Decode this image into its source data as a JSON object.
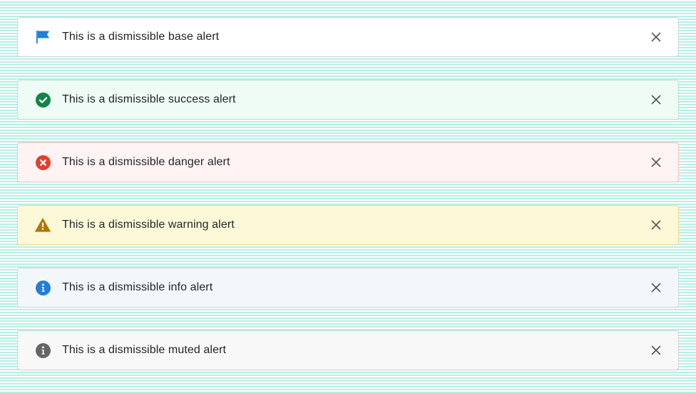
{
  "alerts": [
    {
      "variant": "base",
      "message": "This is a dismissible base alert",
      "icon": "flag-icon",
      "icon_color": "#1f7fd9",
      "dismiss_icon": "close-icon"
    },
    {
      "variant": "success",
      "message": "This is a dismissible success alert",
      "icon": "check-circle-icon",
      "icon_color": "#108548",
      "dismiss_icon": "close-icon"
    },
    {
      "variant": "danger",
      "message": "This is a dismissible danger alert",
      "icon": "error-circle-icon",
      "icon_color": "#e53e2d",
      "dismiss_icon": "close-icon"
    },
    {
      "variant": "warning",
      "message": "This is a dismissible warning alert",
      "icon": "warning-triangle-icon",
      "icon_color": "#b57500",
      "dismiss_icon": "close-icon"
    },
    {
      "variant": "info",
      "message": "This is a dismissible info alert",
      "icon": "info-circle-icon",
      "icon_color": "#1f7fd9",
      "dismiss_icon": "close-icon"
    },
    {
      "variant": "muted",
      "message": "This is a dismissible muted alert",
      "icon": "info-circle-icon",
      "icon_color": "#666666",
      "dismiss_icon": "close-icon"
    }
  ],
  "colors": {
    "background_stripe": "#b6efe6",
    "text": "#1f2427",
    "close_icon": "#555555"
  }
}
